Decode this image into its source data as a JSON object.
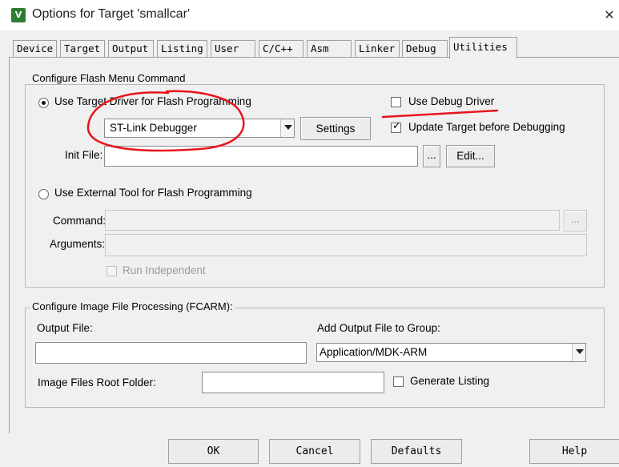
{
  "window": {
    "title": "Options for Target 'smallcar'",
    "app_icon": "keil-uvision-icon",
    "close_glyph": "✕"
  },
  "tabs": [
    {
      "label": "Device"
    },
    {
      "label": "Target"
    },
    {
      "label": "Output"
    },
    {
      "label": "Listing"
    },
    {
      "label": "User"
    },
    {
      "label": "C/C++"
    },
    {
      "label": "Asm"
    },
    {
      "label": "Linker"
    },
    {
      "label": "Debug"
    },
    {
      "label": "Utilities"
    }
  ],
  "active_tab": "Utilities",
  "flash_group": {
    "legend": "Configure Flash Menu Command",
    "use_target_driver": {
      "label": "Use Target Driver for Flash Programming",
      "selected": true
    },
    "driver_select": {
      "value": "ST-Link Debugger"
    },
    "settings_button": "Settings",
    "use_debug_driver": {
      "label": "Use Debug Driver",
      "checked": false
    },
    "update_target": {
      "label": "Update Target before Debugging",
      "checked": true
    },
    "init_file": {
      "label": "Init File:",
      "value": "",
      "browse": "...",
      "edit": "Edit..."
    },
    "use_external_tool": {
      "label": "Use External Tool for Flash Programming",
      "selected": false
    },
    "command": {
      "label": "Command:",
      "value": "",
      "browse": "..."
    },
    "arguments": {
      "label": "Arguments:",
      "value": ""
    },
    "run_independent": {
      "label": "Run Independent",
      "checked": false
    }
  },
  "image_group": {
    "legend": "Configure Image File Processing (FCARM):",
    "output_file": {
      "label": "Output File:",
      "value": ""
    },
    "add_output_group": {
      "label": "Add Output File  to Group:",
      "value": "Application/MDK-ARM"
    },
    "root_folder": {
      "label": "Image Files Root Folder:",
      "value": ""
    },
    "generate_listing": {
      "label": "Generate Listing",
      "checked": false
    }
  },
  "footer": {
    "ok": "OK",
    "cancel": "Cancel",
    "defaults": "Defaults",
    "help": "Help"
  },
  "annotation_color": "#e8141c"
}
